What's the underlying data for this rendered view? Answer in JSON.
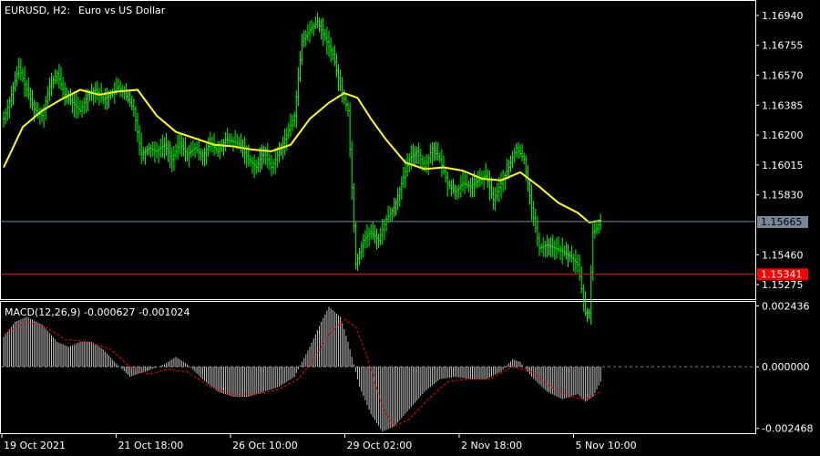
{
  "header": {
    "symbol_timeframe": "EURUSD, H2:",
    "description": "Euro vs US Dollar"
  },
  "macd_header": {
    "label": "MACD(12,26,9) -0.000627 -0.001024"
  },
  "colors": {
    "background": "#000000",
    "bar": "#00ff00",
    "moving_average": "#ffff00",
    "bid_line": "#778899",
    "level_line": "#ff0000",
    "macd_histogram": "#c0c0c0",
    "macd_signal": "#ff0000",
    "frame": "#ffffff"
  },
  "chart_data": [
    {
      "name": "price",
      "type": "ohlc",
      "symbol": "EURUSD",
      "timeframe": "H2",
      "ylim": [
        1.15185,
        1.1703
      ],
      "y_ticks": [
        "1.16940",
        "1.16755",
        "1.16570",
        "1.16385",
        "1.16200",
        "1.16015",
        "1.15830",
        "1.15460",
        "1.15275"
      ],
      "x_ticks": [
        "19 Oct 2021",
        "21 Oct 18:00",
        "26 Oct 10:00",
        "29 Oct 02:00",
        "2 Nov 18:00",
        "5 Nov 10:00"
      ],
      "current_price_label": "1.15665",
      "current_price": 1.15665,
      "level_label": "1.15341",
      "level_price": 1.15341,
      "close_path": [
        [
          0,
          1.163
        ],
        [
          4,
          1.1645
        ],
        [
          8,
          1.1662
        ],
        [
          12,
          1.1648
        ],
        [
          16,
          1.1636
        ],
        [
          20,
          1.1632
        ],
        [
          24,
          1.165
        ],
        [
          28,
          1.1658
        ],
        [
          32,
          1.1645
        ],
        [
          36,
          1.164
        ],
        [
          40,
          1.1635
        ],
        [
          44,
          1.1645
        ],
        [
          48,
          1.1648
        ],
        [
          52,
          1.1642
        ],
        [
          56,
          1.1645
        ],
        [
          60,
          1.165
        ],
        [
          64,
          1.1644
        ],
        [
          68,
          1.1636
        ],
        [
          72,
          1.1608
        ],
        [
          76,
          1.1612
        ],
        [
          80,
          1.161
        ],
        [
          84,
          1.1614
        ],
        [
          88,
          1.1605
        ],
        [
          92,
          1.1615
        ],
        [
          96,
          1.1608
        ],
        [
          100,
          1.1612
        ],
        [
          104,
          1.1607
        ],
        [
          108,
          1.1615
        ],
        [
          112,
          1.161
        ],
        [
          116,
          1.1617
        ],
        [
          120,
          1.1616
        ],
        [
          124,
          1.1614
        ],
        [
          128,
          1.1605
        ],
        [
          132,
          1.16
        ],
        [
          136,
          1.161
        ],
        [
          140,
          1.16
        ],
        [
          144,
          1.161
        ],
        [
          148,
          1.162
        ],
        [
          152,
          1.1632
        ],
        [
          156,
          1.1678
        ],
        [
          160,
          1.1685
        ],
        [
          164,
          1.169
        ],
        [
          168,
          1.168
        ],
        [
          172,
          1.167
        ],
        [
          176,
          1.165
        ],
        [
          180,
          1.1635
        ],
        [
          184,
          1.154
        ],
        [
          188,
          1.1555
        ],
        [
          192,
          1.156
        ],
        [
          196,
          1.1555
        ],
        [
          200,
          1.1568
        ],
        [
          204,
          1.1575
        ],
        [
          208,
          1.159
        ],
        [
          212,
          1.1605
        ],
        [
          216,
          1.161
        ],
        [
          220,
          1.16
        ],
        [
          224,
          1.1612
        ],
        [
          228,
          1.1605
        ],
        [
          232,
          1.159
        ],
        [
          236,
          1.1585
        ],
        [
          240,
          1.159
        ],
        [
          244,
          1.1588
        ],
        [
          248,
          1.1592
        ],
        [
          252,
          1.1595
        ],
        [
          256,
          1.158
        ],
        [
          260,
          1.159
        ],
        [
          264,
          1.16
        ],
        [
          268,
          1.1612
        ],
        [
          272,
          1.1605
        ],
        [
          276,
          1.1575
        ],
        [
          280,
          1.155
        ],
        [
          284,
          1.1552
        ],
        [
          288,
          1.155
        ],
        [
          292,
          1.1548
        ],
        [
          296,
          1.1545
        ],
        [
          300,
          1.154
        ],
        [
          304,
          1.151
        ],
        [
          306,
          1.151
        ],
        [
          308,
          1.156
        ],
        [
          310,
          1.1562
        ],
        [
          312,
          1.1567
        ]
      ],
      "moving_average": [
        [
          0,
          1.16
        ],
        [
          10,
          1.1625
        ],
        [
          20,
          1.1635
        ],
        [
          30,
          1.1642
        ],
        [
          40,
          1.1648
        ],
        [
          50,
          1.1645
        ],
        [
          60,
          1.1647
        ],
        [
          70,
          1.1648
        ],
        [
          80,
          1.1632
        ],
        [
          90,
          1.1622
        ],
        [
          100,
          1.1618
        ],
        [
          110,
          1.1614
        ],
        [
          120,
          1.1613
        ],
        [
          130,
          1.1611
        ],
        [
          140,
          1.161
        ],
        [
          150,
          1.1614
        ],
        [
          160,
          1.163
        ],
        [
          170,
          1.164
        ],
        [
          178,
          1.1646
        ],
        [
          185,
          1.1643
        ],
        [
          192,
          1.163
        ],
        [
          200,
          1.1617
        ],
        [
          210,
          1.1603
        ],
        [
          220,
          1.1599
        ],
        [
          230,
          1.16
        ],
        [
          240,
          1.1598
        ],
        [
          250,
          1.1593
        ],
        [
          260,
          1.1592
        ],
        [
          270,
          1.1597
        ],
        [
          280,
          1.1588
        ],
        [
          290,
          1.1578
        ],
        [
          300,
          1.1572
        ],
        [
          306,
          1.1566
        ],
        [
          312,
          1.1567
        ]
      ]
    },
    {
      "name": "macd",
      "type": "histogram",
      "indicator": "MACD(12,26,9)",
      "macd_value": -0.000627,
      "signal_value": -0.001024,
      "ylim": [
        -0.00266,
        0.0026
      ],
      "y_ticks": [
        "0.002436",
        "0.000000",
        "-0.002468"
      ],
      "histogram_path": [
        [
          0,
          0.0012
        ],
        [
          6,
          0.0018
        ],
        [
          12,
          0.002
        ],
        [
          20,
          0.0017
        ],
        [
          28,
          0.001
        ],
        [
          34,
          0.0008
        ],
        [
          40,
          0.001
        ],
        [
          46,
          0.001
        ],
        [
          52,
          0.0007
        ],
        [
          58,
          0.0002
        ],
        [
          66,
          -0.0004
        ],
        [
          74,
          -0.0002
        ],
        [
          84,
          0.0001
        ],
        [
          90,
          0.0004
        ],
        [
          96,
          0.0001
        ],
        [
          104,
          -0.0005
        ],
        [
          112,
          -0.001
        ],
        [
          120,
          -0.0012
        ],
        [
          128,
          -0.0012
        ],
        [
          136,
          -0.001
        ],
        [
          144,
          -0.0008
        ],
        [
          152,
          -0.0004
        ],
        [
          160,
          0.0008
        ],
        [
          166,
          0.0018
        ],
        [
          170,
          0.0024
        ],
        [
          176,
          0.002
        ],
        [
          180,
          0.001
        ],
        [
          186,
          -0.0008
        ],
        [
          192,
          -0.0019
        ],
        [
          198,
          -0.0026
        ],
        [
          204,
          -0.0024
        ],
        [
          212,
          -0.0017
        ],
        [
          220,
          -0.001
        ],
        [
          228,
          -0.0005
        ],
        [
          236,
          -0.0004
        ],
        [
          244,
          -0.0005
        ],
        [
          252,
          -0.0005
        ],
        [
          260,
          -0.0002
        ],
        [
          266,
          0.0003
        ],
        [
          270,
          0.0002
        ],
        [
          276,
          -0.0004
        ],
        [
          284,
          -0.001
        ],
        [
          292,
          -0.0013
        ],
        [
          300,
          -0.0011
        ],
        [
          304,
          -0.0014
        ],
        [
          308,
          -0.0012
        ],
        [
          312,
          -0.0006
        ]
      ],
      "signal_path": [
        [
          0,
          0.0013
        ],
        [
          12,
          0.0018
        ],
        [
          22,
          0.0016
        ],
        [
          32,
          0.0011
        ],
        [
          44,
          0.001
        ],
        [
          56,
          0.0007
        ],
        [
          66,
          0.0
        ],
        [
          76,
          -0.0003
        ],
        [
          86,
          -0.0001
        ],
        [
          96,
          -0.0002
        ],
        [
          108,
          -0.0008
        ],
        [
          120,
          -0.0011
        ],
        [
          132,
          -0.0011
        ],
        [
          144,
          -0.0009
        ],
        [
          154,
          -0.0005
        ],
        [
          162,
          0.0003
        ],
        [
          170,
          0.0013
        ],
        [
          178,
          0.0019
        ],
        [
          184,
          0.0016
        ],
        [
          190,
          0.0004
        ],
        [
          198,
          -0.0016
        ],
        [
          204,
          -0.0024
        ],
        [
          212,
          -0.0021
        ],
        [
          222,
          -0.0013
        ],
        [
          232,
          -0.0006
        ],
        [
          242,
          -0.0005
        ],
        [
          254,
          -0.0005
        ],
        [
          266,
          0.0
        ],
        [
          276,
          -0.0002
        ],
        [
          286,
          -0.0008
        ],
        [
          296,
          -0.0012
        ],
        [
          304,
          -0.0013
        ],
        [
          312,
          -0.001
        ]
      ]
    }
  ]
}
